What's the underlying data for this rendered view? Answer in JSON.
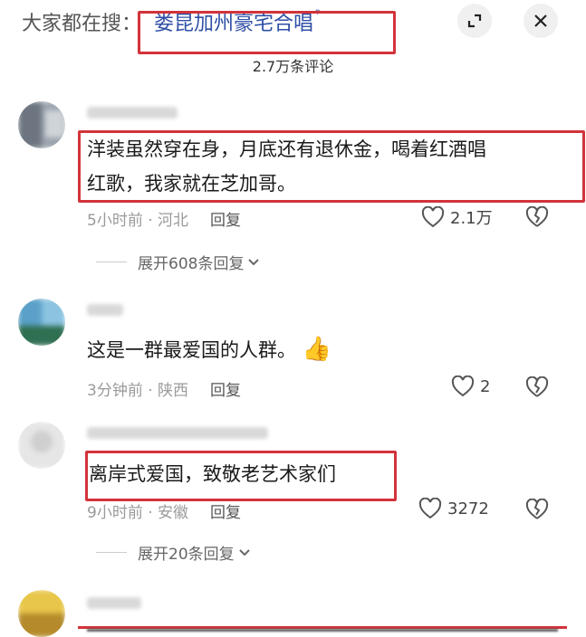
{
  "header": {
    "search_prefix": "大家都在搜：",
    "search_term": "娄昆加州豪宅合唱",
    "search_icon_glyph": "ᵠ",
    "comment_count": "2.7万条评论"
  },
  "comments": [
    {
      "text_line1": "洋装虽然穿在身，月底还有退休金，喝着红酒唱",
      "text_line2": "红歌，我家就在芝加哥。",
      "time": "5小时前",
      "location": "河北",
      "reply_label": "回复",
      "likes": "2.1万",
      "expand_label": "展开608条回复"
    },
    {
      "text": "这是一群最爱国的人群。",
      "emoji": "👍",
      "time": "3分钟前",
      "location": "陕西",
      "reply_label": "回复",
      "likes": "2"
    },
    {
      "text": "离岸式爱国，致敬老艺术家们",
      "time": "9小时前",
      "location": "安徽",
      "reply_label": "回复",
      "likes": "3272",
      "expand_label": "展开20条回复"
    }
  ],
  "separator": " · ",
  "colors": {
    "highlight_box": "#d2333b",
    "search_term": "#2f4fa6"
  }
}
